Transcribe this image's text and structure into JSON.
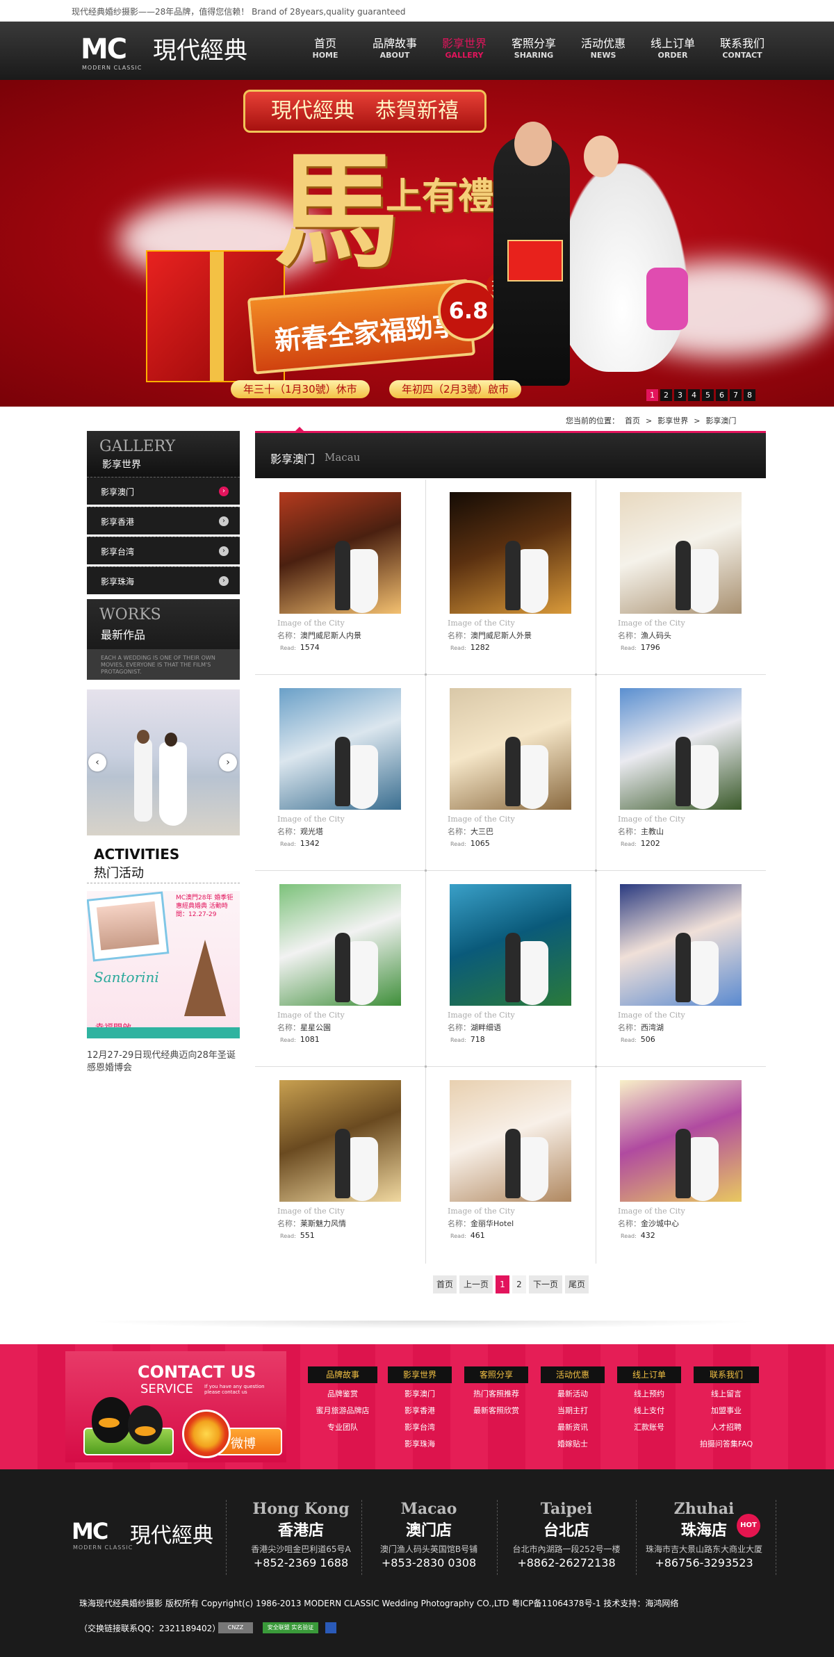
{
  "top_strip": {
    "text": "现代经典婚纱摄影——28年品牌，值得您信赖！ Brand of 28years,quality guaranteed"
  },
  "logo": {
    "mc": "MC",
    "cn": "現代經典",
    "en": "MODERN CLASSIC"
  },
  "nav": [
    {
      "cn": "首页",
      "en": "HOME"
    },
    {
      "cn": "品牌故事",
      "en": "ABOUT"
    },
    {
      "cn": "影享世界",
      "en": "GALLERY",
      "active": true
    },
    {
      "cn": "客照分享",
      "en": "SHARING"
    },
    {
      "cn": "活动优惠",
      "en": "NEWS"
    },
    {
      "cn": "线上订单",
      "en": "ORDER"
    },
    {
      "cn": "联系我们",
      "en": "CONTACT"
    }
  ],
  "banner": {
    "ribbon": "現代經典　恭賀新禧",
    "big_char": "馬",
    "small_chars": "上有禮",
    "promo": "新春全家福勁享",
    "discount": "6.8",
    "discount_unit": "折",
    "date_left": "年三十（1月30號）休市",
    "date_right": "年初四（2月3號）啟市",
    "slides": [
      "1",
      "2",
      "3",
      "4",
      "5",
      "6",
      "7",
      "8"
    ],
    "active_slide": 1
  },
  "breadcrumb": {
    "prefix": "您当前的位置：",
    "items": [
      "首页",
      ">",
      "影享世界",
      ">",
      "影享澳门"
    ]
  },
  "sidebar": {
    "gallery_en": "GALLERY",
    "gallery_cn": "影享世界",
    "items": [
      {
        "label": "影享澳门",
        "active": true
      },
      {
        "label": "影享香港"
      },
      {
        "label": "影享台湾"
      },
      {
        "label": "影享珠海"
      }
    ],
    "works_en": "WORKS",
    "works_cn": "最新作品",
    "works_desc": "EACH A WEDDING IS ONE OF THEIR OWN MOVIES, EVERYONE IS THAT THE FILM'S PROTAGONIST.",
    "activities_en": "ACTIVITIES",
    "activities_cn": "热门活动",
    "act_img_text1": "MC澳門28年 婚季钜惠經典婚典 活動時間：12.27-29",
    "act_img_text2": "Santorini",
    "act_img_text3": "幸福開啟",
    "activity_caption": "12月27-29日现代经典迈向28年圣诞感恩婚博会"
  },
  "main": {
    "title_cn": "影享澳门",
    "title_en": "Macau",
    "caption_en": "Image of the City",
    "name_key": "名称：",
    "read_key": "Read:",
    "items": [
      {
        "name": "澳門威尼斯人内景",
        "read": "1574",
        "palette": [
          "#b43a1e",
          "#f3c070",
          "#4a2010"
        ]
      },
      {
        "name": "澳門威尼斯人外景",
        "read": "1282",
        "palette": [
          "#150c05",
          "#d99a3a",
          "#5a3010"
        ]
      },
      {
        "name": "漁人码头",
        "read": "1796",
        "palette": [
          "#e8d9c0",
          "#a89070",
          "#f5f2ea"
        ]
      },
      {
        "name": "观光塔",
        "read": "1342",
        "palette": [
          "#6aa0c8",
          "#3a6e90",
          "#dbe6ee"
        ]
      },
      {
        "name": "大三巴",
        "read": "1065",
        "palette": [
          "#d9c8a8",
          "#8a6a40",
          "#f5e6c8"
        ]
      },
      {
        "name": "主教山",
        "read": "1202",
        "palette": [
          "#5a8fd0",
          "#3a5a2a",
          "#eaeaf0"
        ]
      },
      {
        "name": "星星公園",
        "read": "1081",
        "palette": [
          "#7cc27a",
          "#3f8f3a",
          "#f2f2f2"
        ]
      },
      {
        "name": "湖畔细语",
        "read": "718",
        "palette": [
          "#3aa0c8",
          "#2a7a3a",
          "#0a5a7a"
        ]
      },
      {
        "name": "西湾湖",
        "read": "506",
        "palette": [
          "#2a3a80",
          "#5a8ad0",
          "#f0e0d8"
        ]
      },
      {
        "name": "莱斯魅力风情",
        "read": "551",
        "palette": [
          "#c8a050",
          "#f0d8a0",
          "#6a4a20"
        ]
      },
      {
        "name": "金丽华Hotel",
        "read": "461",
        "palette": [
          "#e8d0b0",
          "#b08860",
          "#f8f0e8"
        ]
      },
      {
        "name": "金沙城中心",
        "read": "432",
        "palette": [
          "#f8f0c8",
          "#e8c860",
          "#b04aa0"
        ]
      }
    ]
  },
  "pagination": {
    "first": "首页",
    "prev": "上一页",
    "pages": [
      "1",
      "2"
    ],
    "active_page": "1",
    "next": "下一页",
    "last": "尾页"
  },
  "footer_contact": {
    "title": "CONTACT US",
    "subtitle": "SERVICE",
    "note": "If you have any question please contact us",
    "weibo": "微博"
  },
  "footer_columns": [
    {
      "head": "品牌故事",
      "links": [
        "品牌鉴赏",
        "蜜月旅游品牌店",
        "专业团队"
      ]
    },
    {
      "head": "影享世界",
      "links": [
        "影享澳门",
        "影享香港",
        "影享台湾",
        "影享珠海"
      ]
    },
    {
      "head": "客照分享",
      "links": [
        "热门客照推荐",
        "最新客照欣赏"
      ]
    },
    {
      "head": "活动优惠",
      "links": [
        "最新活动",
        "当期主打",
        "最新资讯",
        "婚嫁贴士"
      ]
    },
    {
      "head": "线上订单",
      "links": [
        "线上预约",
        "线上支付",
        "汇款账号"
      ]
    },
    {
      "head": "联系我们",
      "links": [
        "线上留言",
        "加盟事业",
        "人才招聘",
        "拍摄问答集FAQ"
      ]
    }
  ],
  "stores": [
    {
      "en": "Hong Kong",
      "cn": "香港店",
      "addr": "香港尖沙咀金巴利道65号A",
      "tel": "+852-2369 1688"
    },
    {
      "en": "Macao",
      "cn": "澳门店",
      "addr": "澳门渔人码头英国馆B号铺",
      "tel": "+853-2830 0308"
    },
    {
      "en": "Taipei",
      "cn": "台北店",
      "addr": "台北市內湖路一段252号一楼",
      "tel": "+8862-26272138"
    },
    {
      "en": "Zhuhai",
      "cn": "珠海店",
      "addr": "珠海市吉大景山路东大商业大厦",
      "tel": "+86756-3293523"
    }
  ],
  "hot_badge": "HOT",
  "copyright": "珠海现代经典婚纱摄影 版权所有 Copyright(c) 1986-2013 MODERN CLASSIC Wedding Photography CO.,LTD 粤ICP备11064378号-1 技术支持：海鸿网络",
  "exchange_links": "（交换链接联系QQ：2321189402）",
  "badges": [
    "CNZZ",
    "安全联盟 实名验证"
  ]
}
